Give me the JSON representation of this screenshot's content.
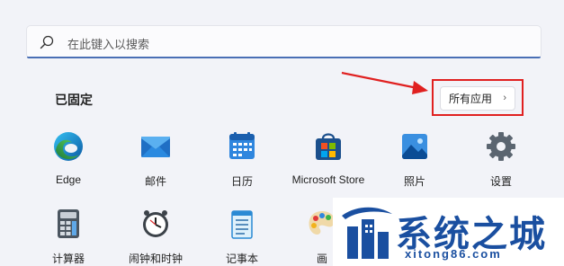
{
  "search": {
    "placeholder": "在此键入以搜索"
  },
  "pinned": {
    "title": "已固定",
    "all_apps_label": "所有应用",
    "all_apps_chevron": "›"
  },
  "apps": [
    {
      "label": "Edge",
      "icon": "edge-icon"
    },
    {
      "label": "邮件",
      "icon": "mail-icon"
    },
    {
      "label": "日历",
      "icon": "calendar-icon"
    },
    {
      "label": "Microsoft Store",
      "icon": "store-icon"
    },
    {
      "label": "照片",
      "icon": "photos-icon"
    },
    {
      "label": "设置",
      "icon": "settings-icon"
    },
    {
      "label": "计算器",
      "icon": "calculator-icon"
    },
    {
      "label": "闹钟和时钟",
      "icon": "clock-icon"
    },
    {
      "label": "记事本",
      "icon": "notepad-icon"
    },
    {
      "label": "画",
      "icon": "paint-icon"
    }
  ],
  "watermark": {
    "title": "系统之城",
    "url": "xitong86.com"
  },
  "colors": {
    "accent": "#4a6fb5",
    "highlight": "#e02020",
    "watermark": "#1a4fa0"
  }
}
